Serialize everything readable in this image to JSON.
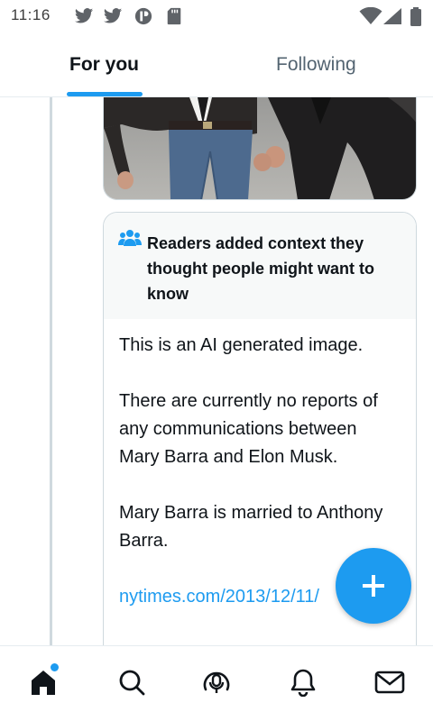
{
  "status_bar": {
    "time": "11:16",
    "icons": [
      "twitter-icon",
      "twitter-icon",
      "app-icon",
      "sd-card-icon",
      "wifi-icon",
      "signal-icon",
      "battery-icon"
    ]
  },
  "tabs": [
    {
      "label": "For you",
      "selected": true
    },
    {
      "label": "Following",
      "selected": false
    }
  ],
  "community_note": {
    "icon": "people-icon",
    "title": "Readers added context they thought people might want to know",
    "paragraphs": [
      "This is an AI generated image.",
      "There are currently no reports of any communications between Mary Barra and Elon Musk.",
      "Mary Barra is married to Anthony Barra."
    ],
    "link": "nytimes.com/2013/12/11/"
  },
  "fab": {
    "icon": "compose-plus-icon"
  },
  "bottom_nav": [
    {
      "name": "home",
      "icon": "home-icon",
      "has_notification_dot": true
    },
    {
      "name": "search",
      "icon": "search-icon"
    },
    {
      "name": "spaces",
      "icon": "spaces-icon"
    },
    {
      "name": "notifications",
      "icon": "bell-icon"
    },
    {
      "name": "messages",
      "icon": "mail-icon"
    }
  ],
  "colors": {
    "accent": "#1d9bf0",
    "text": "#0f1419",
    "muted": "#536471",
    "note_header_bg": "#f7f9f9",
    "border": "#cfd9de"
  }
}
